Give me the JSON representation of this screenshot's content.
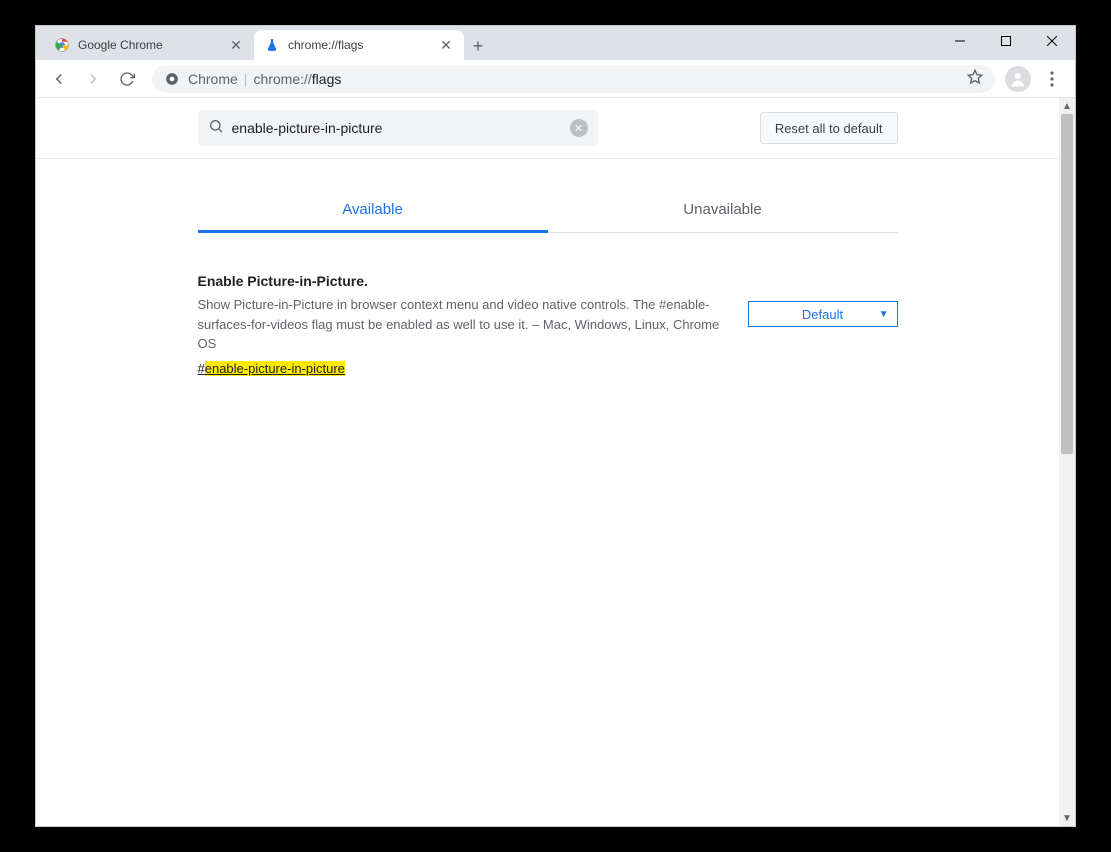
{
  "window": {
    "tabs": [
      {
        "title": "Google Chrome",
        "active": false
      },
      {
        "title": "chrome://flags",
        "active": true
      }
    ]
  },
  "addressbar": {
    "prefix": "Chrome",
    "path_prefix": "chrome://",
    "path_bold": "flags"
  },
  "header": {
    "search_value": "enable-picture-in-picture",
    "reset_label": "Reset all to default"
  },
  "page_tabs": {
    "available": "Available",
    "unavailable": "Unavailable"
  },
  "flag": {
    "title": "Enable Picture-in-Picture.",
    "description": "Show Picture-in-Picture in browser context menu and video native controls. The #enable-surfaces-for-videos flag must be enabled as well to use it. – Mac, Windows, Linux, Chrome OS",
    "hash": "#",
    "link_highlight": "enable-picture-in-picture",
    "select_value": "Default"
  }
}
